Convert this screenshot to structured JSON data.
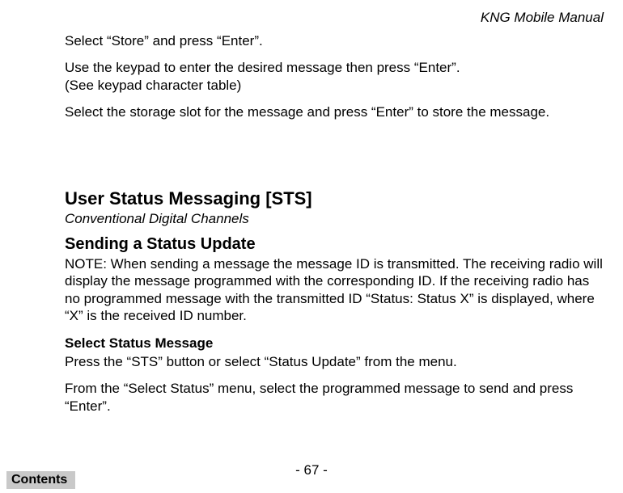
{
  "header": {
    "title": "KNG Mobile Manual"
  },
  "intro": {
    "p1": "Select “Store” and press “Enter”.",
    "p2a": "Use the keypad to enter the desired message then press “Enter”.",
    "p2b": "(See keypad character table)",
    "p3": "Select the storage slot for the message and press “Enter” to store the message."
  },
  "section": {
    "heading": "User Status Messaging [STS]",
    "subtitle": "Conventional Digital Channels"
  },
  "sub1": {
    "heading": "Sending a Status Update",
    "note": "NOTE: When sending a message the message ID is transmitted. The receiving radio will display the message programmed with the corresponding ID. If the receiving radio has no programmed message with the transmitted ID “Status: Status X” is displayed, where “X” is the received ID number."
  },
  "sub2": {
    "heading": "Select Status Message",
    "p1": "Press the “STS” button or select “Status Update” from the menu.",
    "p2": "From the “Select Status” menu, select the programmed message to send and press “Enter”."
  },
  "footer": {
    "page": "- 67 -",
    "contents": "Contents"
  }
}
